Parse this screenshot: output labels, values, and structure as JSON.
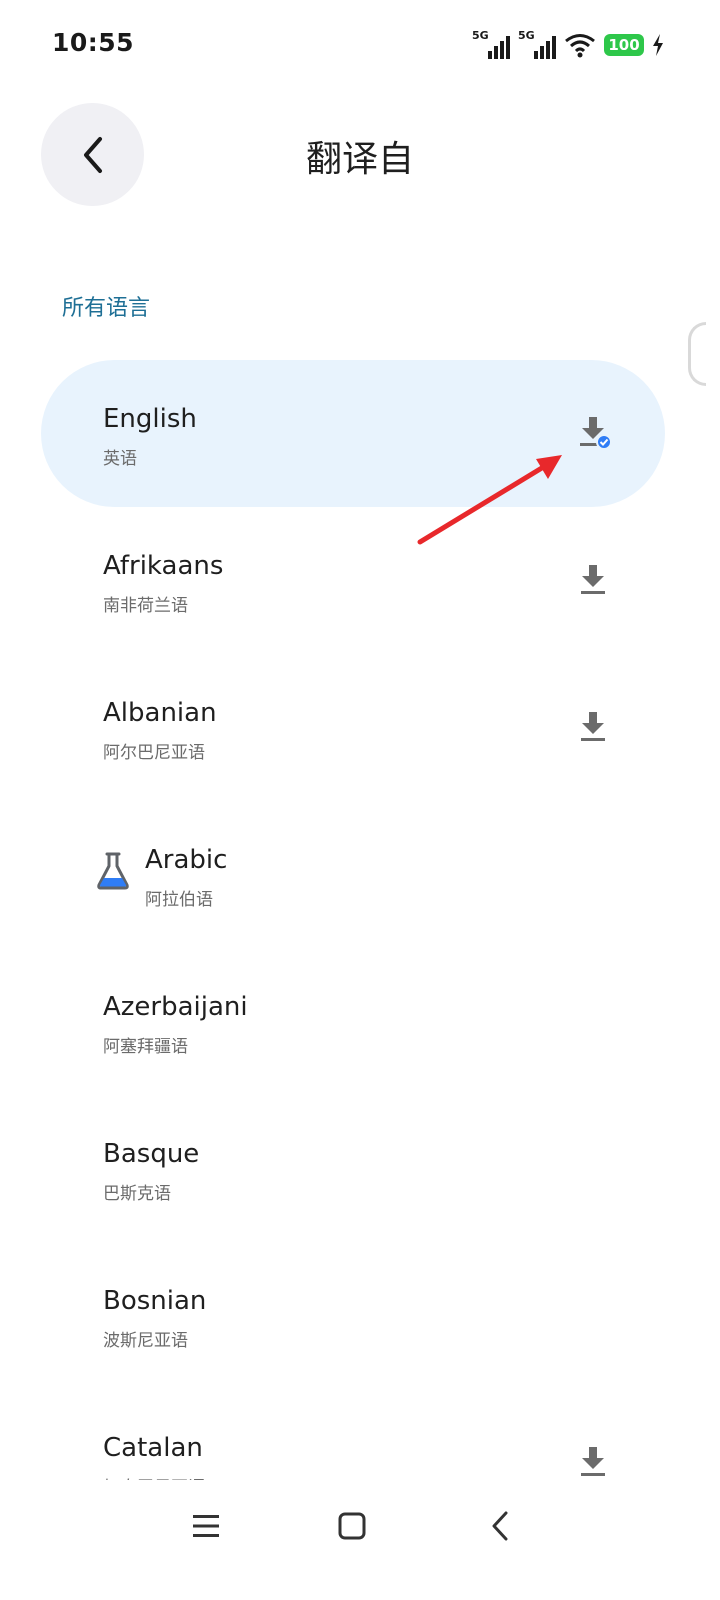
{
  "status_bar": {
    "time": "10:55",
    "network_1": "5G",
    "network_2": "5G",
    "battery": "100"
  },
  "header": {
    "title": "翻译自"
  },
  "section": {
    "label": "所有语言"
  },
  "languages": [
    {
      "name": "English",
      "native": "英语",
      "selected": true,
      "download_state": "downloaded"
    },
    {
      "name": "Afrikaans",
      "native": "南非荷兰语",
      "selected": false,
      "download_state": "available"
    },
    {
      "name": "Albanian",
      "native": "阿尔巴尼亚语",
      "selected": false,
      "download_state": "available"
    },
    {
      "name": "Arabic",
      "native": "阿拉伯语",
      "selected": false,
      "download_state": "none",
      "experimental": true
    },
    {
      "name": "Azerbaijani",
      "native": "阿塞拜疆语",
      "selected": false,
      "download_state": "none"
    },
    {
      "name": "Basque",
      "native": "巴斯克语",
      "selected": false,
      "download_state": "none"
    },
    {
      "name": "Bosnian",
      "native": "波斯尼亚语",
      "selected": false,
      "download_state": "none"
    },
    {
      "name": "Catalan",
      "native": "加泰罗尼亚语",
      "selected": false,
      "download_state": "available"
    }
  ],
  "icons": {
    "back": "chevron-left-icon",
    "download": "download-icon",
    "downloaded": "download-done-icon",
    "experimental": "flask-icon",
    "nav_menu": "menu-icon",
    "nav_home": "home-square-icon",
    "nav_back": "back-chevron-icon"
  },
  "colors": {
    "accent": "#1e6f95",
    "selected_bg": "#e8f3fd",
    "check_badge": "#2f7df6",
    "battery": "#2ec74a",
    "annotation": "#e8282b"
  }
}
